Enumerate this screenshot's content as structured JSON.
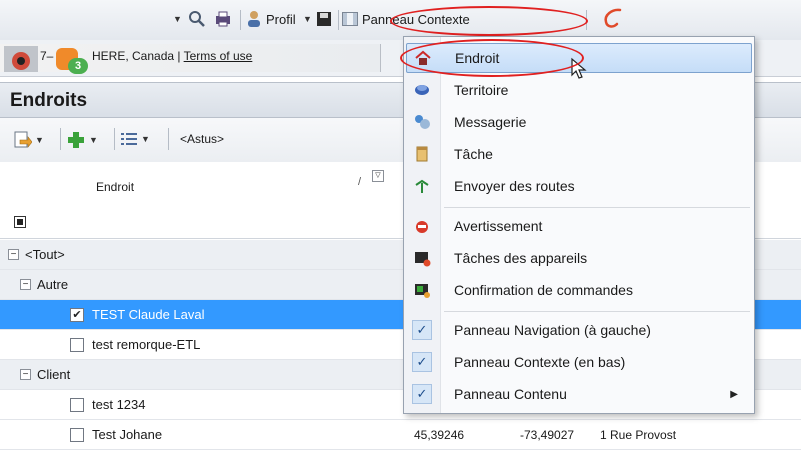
{
  "toolbar": {
    "profile_label": "Profil",
    "context_panel_label": "Panneau Contexte"
  },
  "map": {
    "badge_count": "3",
    "attribution_prefix": "7–",
    "attribution_text": "HERE, Canada | ",
    "terms_link": "Terms of use"
  },
  "panel": {
    "title": "Endroits",
    "filter_label": "<Astus>",
    "column_endroit": "Endroit"
  },
  "tree": {
    "root_label": "<Tout>",
    "groups": [
      {
        "label": "Autre",
        "items": [
          {
            "label": "TEST Claude Laval",
            "checked": true
          },
          {
            "label": "test remorque-ETL",
            "checked": false
          }
        ]
      },
      {
        "label": "Client",
        "items": [
          {
            "label": "test 1234",
            "checked": false
          },
          {
            "label": "Test Johane",
            "checked": false,
            "lat": "45,39246",
            "lon": "-73,49027",
            "address": "1 Rue Provost"
          }
        ]
      }
    ]
  },
  "menu": {
    "items": [
      {
        "label": "Endroit",
        "icon": "place-icon"
      },
      {
        "label": "Territoire",
        "icon": "territory-icon"
      },
      {
        "label": "Messagerie",
        "icon": "messaging-icon"
      },
      {
        "label": "Tâche",
        "icon": "task-icon"
      },
      {
        "label": "Envoyer des routes",
        "icon": "send-routes-icon"
      },
      {
        "label": "Avertissement",
        "icon": "warning-icon"
      },
      {
        "label": "Tâches des appareils",
        "icon": "device-tasks-icon"
      },
      {
        "label": "Confirmation de commandes",
        "icon": "order-confirmation-icon"
      },
      {
        "label": "Panneau Navigation (à gauche)",
        "checked": true
      },
      {
        "label": "Panneau Contexte (en bas)",
        "checked": true
      },
      {
        "label": "Panneau Contenu",
        "checked": true,
        "submenu": true
      }
    ]
  },
  "colors": {
    "selection": "#3399ff",
    "highlight_ring": "#e02020",
    "menu_hover": "#c5ddf8"
  }
}
